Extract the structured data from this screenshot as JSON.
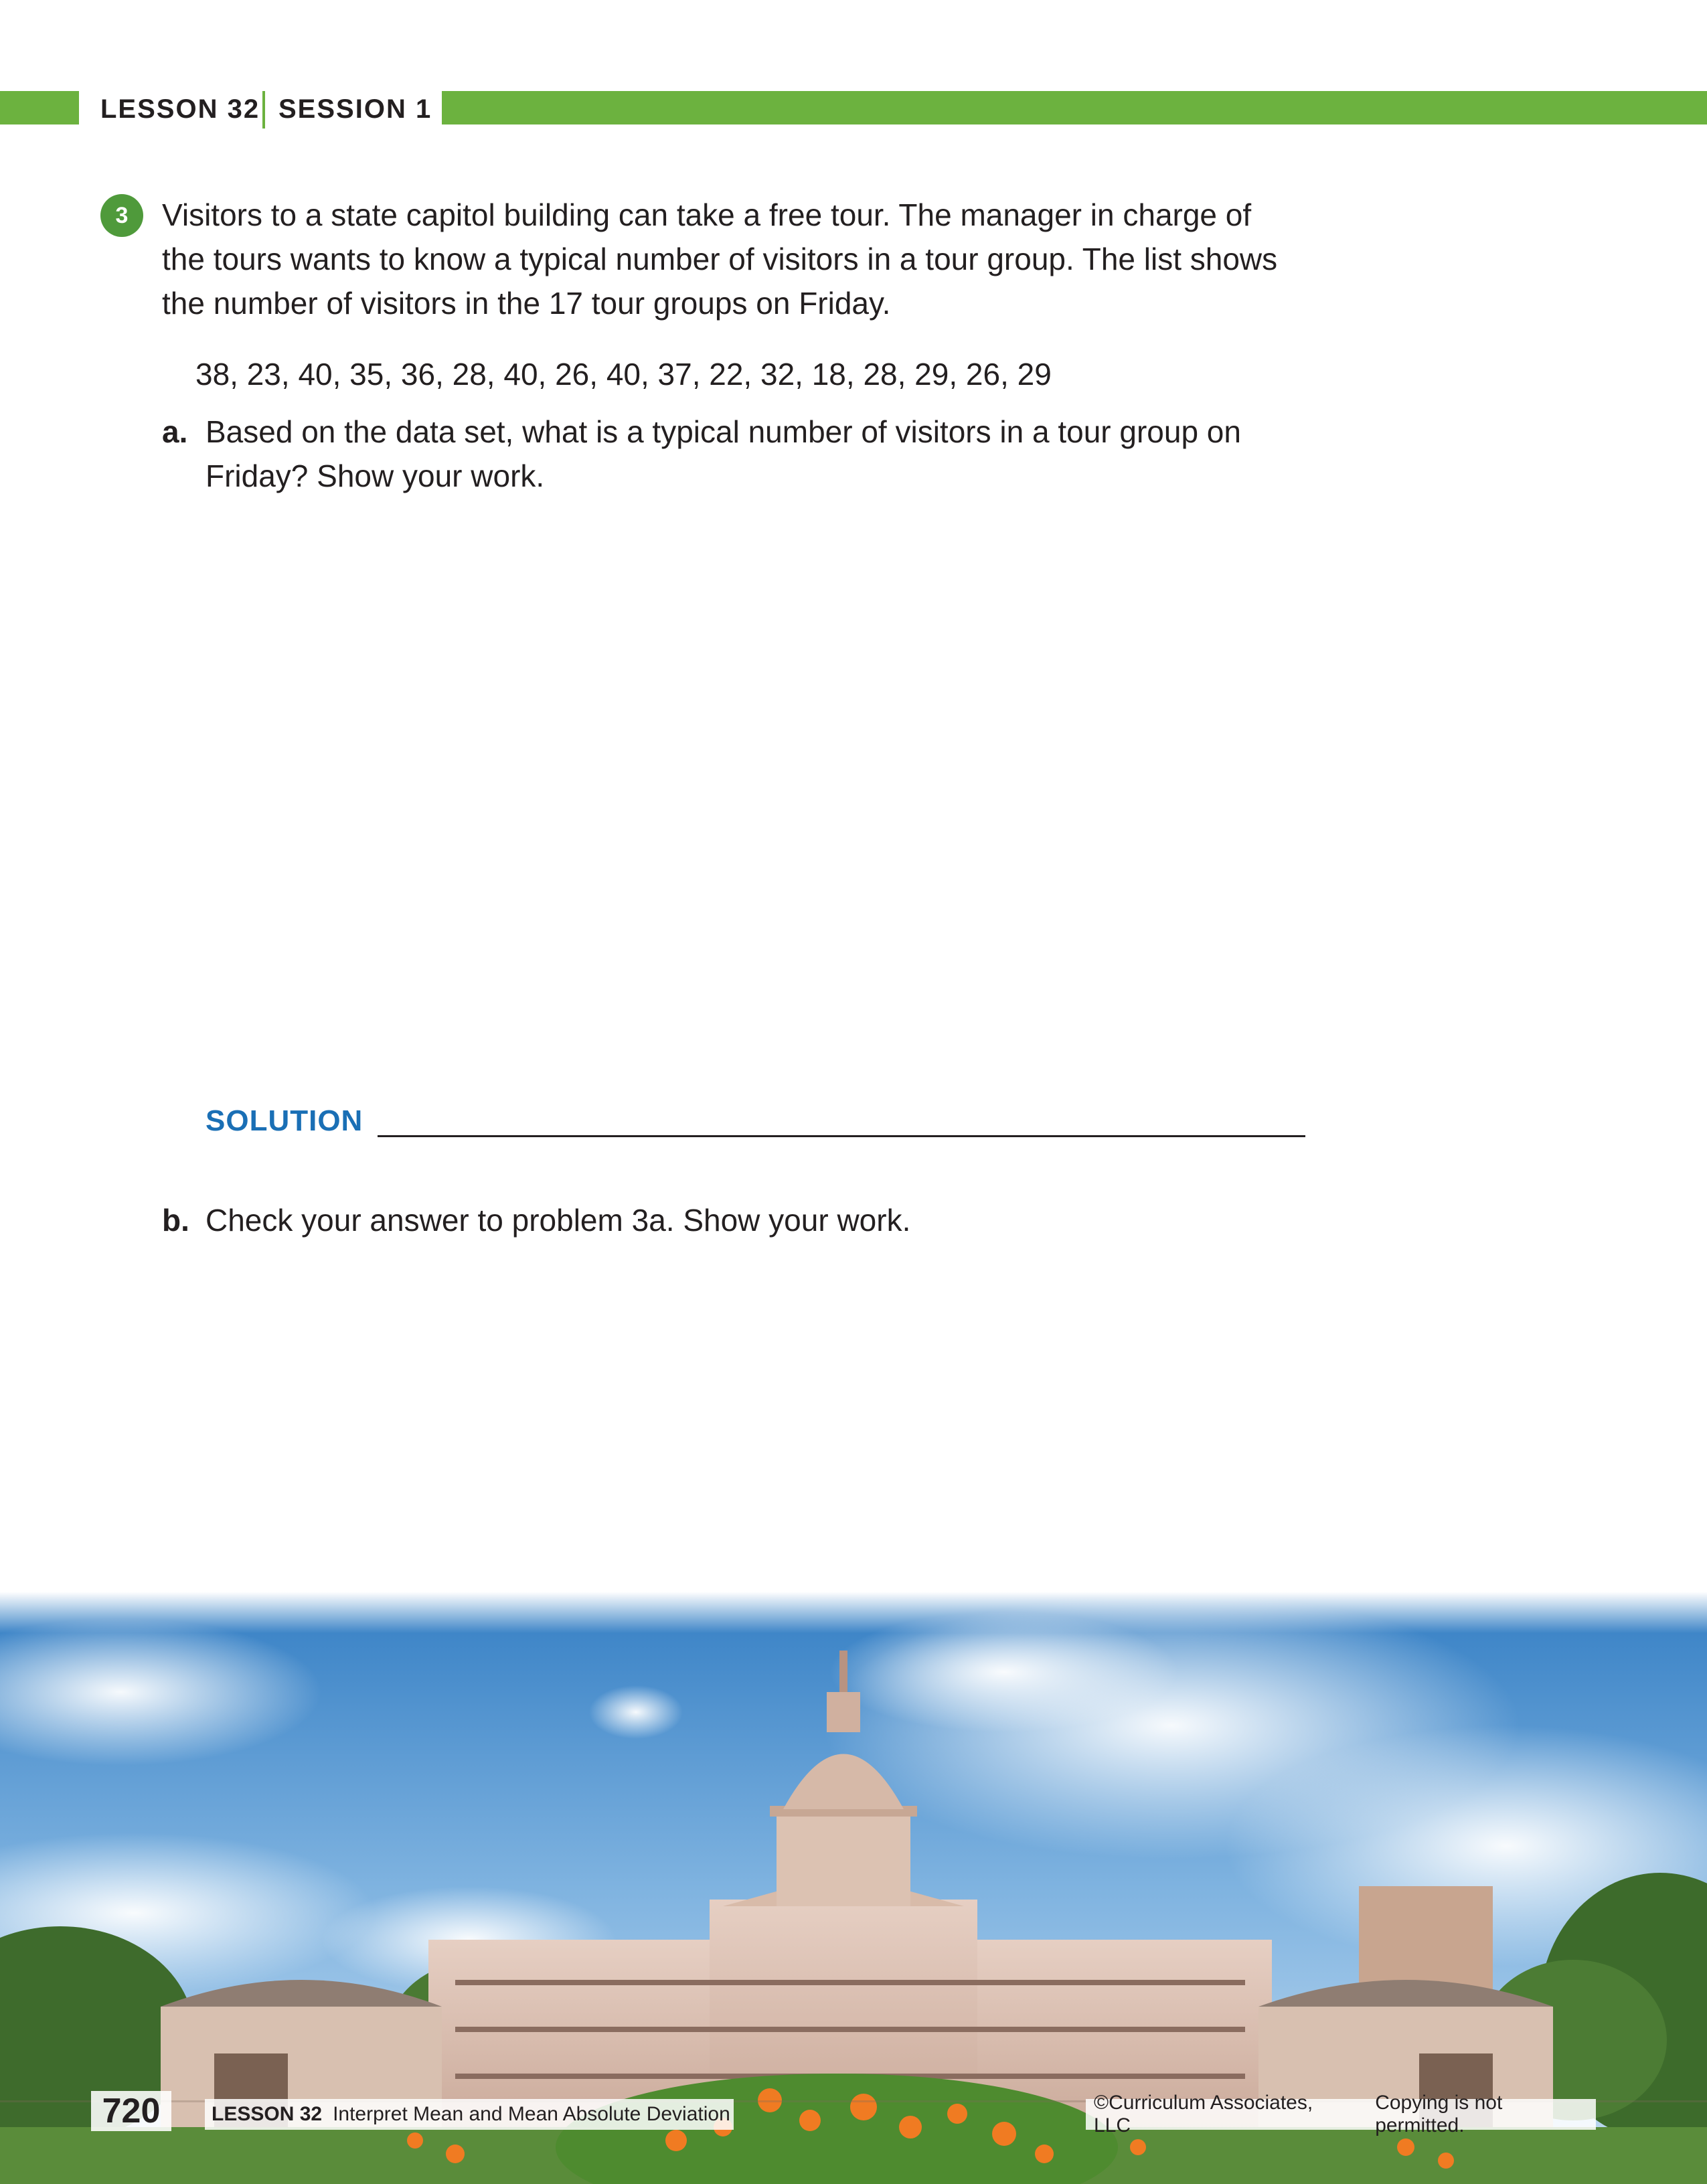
{
  "header": {
    "lesson": "LESSON 32",
    "session": "SESSION 1"
  },
  "problem": {
    "number": "3",
    "intro_lines": [
      "Visitors to a state capitol building can take a free tour. The manager in charge of",
      "the tours wants to know a typical number of visitors in a tour group. The list shows",
      "the number of visitors in the 17 tour groups on Friday."
    ],
    "data_list": "38,  23,  40,  35,  36,  28,  40,  26,  40,  37,  22,  32,  18,  28,  29,  26,  29",
    "part_a": {
      "label": "a.",
      "lines": [
        "Based on the data set, what is a typical number of visitors in a tour group on",
        "Friday? Show your work."
      ]
    },
    "solution_label": "SOLUTION",
    "part_b": {
      "label": "b.",
      "text": "Check your answer to problem 3a. Show your work."
    }
  },
  "footer": {
    "page_number": "720",
    "lesson": "LESSON 32",
    "lesson_title": "Interpret Mean and Mean Absolute Deviation",
    "copyright": "©Curriculum Associates, LLC",
    "notice": "Copying is not permitted."
  },
  "colors": {
    "accent_green": "#6cb23f",
    "number_badge": "#4f9a3b",
    "solution_blue": "#1a6fb5"
  }
}
